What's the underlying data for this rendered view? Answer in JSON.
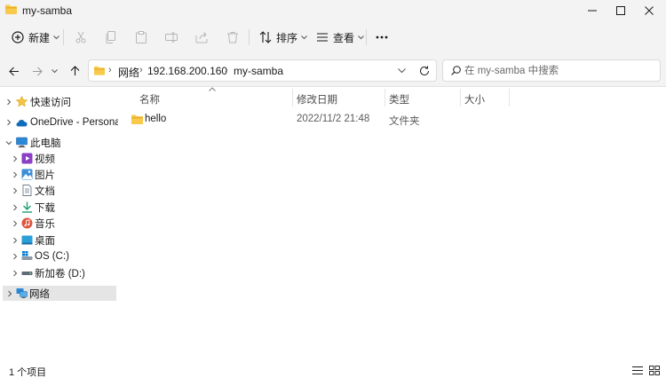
{
  "window": {
    "title": "my-samba",
    "minimize_icon": "minimize-icon",
    "maximize_icon": "maximize-icon",
    "close_icon": "close-icon"
  },
  "toolbar": {
    "new_label": "新建",
    "sort_label": "排序",
    "view_label": "查看",
    "icons": [
      "cut-icon",
      "copy-icon",
      "paste-icon",
      "rename-icon",
      "share-icon",
      "delete-icon",
      "more-icon"
    ]
  },
  "address": {
    "breadcrumbs": [
      "网络",
      "192.168.200.160",
      "my-samba"
    ]
  },
  "search": {
    "placeholder": "在 my-samba 中搜索"
  },
  "sidebar": {
    "items": [
      {
        "label": "快速访问",
        "icon": "star-icon"
      },
      {
        "label": "OneDrive - Personal",
        "icon": "cloud-icon"
      },
      {
        "label": "此电脑",
        "icon": "computer-icon"
      },
      {
        "label": "视频",
        "icon": "video-icon"
      },
      {
        "label": "图片",
        "icon": "picture-icon"
      },
      {
        "label": "文档",
        "icon": "document-icon"
      },
      {
        "label": "下载",
        "icon": "download-icon"
      },
      {
        "label": "音乐",
        "icon": "music-icon"
      },
      {
        "label": "桌面",
        "icon": "desktop-icon"
      },
      {
        "label": "OS (C:)",
        "icon": "drive-c-icon"
      },
      {
        "label": "新加卷 (D:)",
        "icon": "drive-d-icon"
      },
      {
        "label": "网络",
        "icon": "network-icon"
      }
    ]
  },
  "columns": {
    "name": "名称",
    "modified": "修改日期",
    "type": "类型",
    "size": "大小"
  },
  "files": [
    {
      "name": "hello",
      "modified": "2022/11/2 21:48",
      "type": "文件夹",
      "size": ""
    }
  ],
  "status": {
    "item_count": "1 个项目"
  },
  "colors": {
    "folder": "#f8c94a",
    "accent": "#0067c0",
    "selected": "#e5e5e5"
  }
}
